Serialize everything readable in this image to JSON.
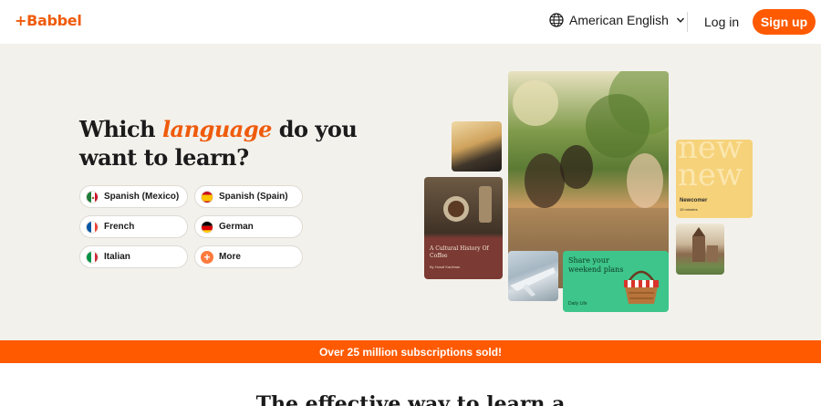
{
  "header": {
    "logo": "+Babbel",
    "language_selector": "American English",
    "login_label": "Log in",
    "signup_label": "Sign up"
  },
  "hero": {
    "title_before": "Which ",
    "title_highlight": "language",
    "title_after": " do you want to learn?",
    "languages": [
      {
        "label": "Spanish (Mexico)",
        "icon": "mexico-flag-icon"
      },
      {
        "label": "Spanish (Spain)",
        "icon": "spain-flag-icon"
      },
      {
        "label": "French",
        "icon": "france-flag-icon"
      },
      {
        "label": "German",
        "icon": "germany-flag-icon"
      },
      {
        "label": "Italian",
        "icon": "italy-flag-icon"
      },
      {
        "label": "More",
        "icon": "plus-icon"
      }
    ]
  },
  "collage": {
    "book_title": "A Cultural History Of Coffee",
    "book_author": "By Hosaf Kaufman",
    "newcomer_word": "new new",
    "newcomer_label": "Newcomer",
    "newcomer_sub": "10 minutes",
    "share_title": "Share your weekend plans",
    "share_tag": "Daily Life"
  },
  "banner": {
    "text": "Over 25 million subscriptions sold!"
  },
  "section": {
    "title": "The effective way to learn a"
  },
  "colors": {
    "brand_orange": "#ff5a00",
    "hero_bg": "#f3f1ec",
    "share_green": "#3ec58b"
  }
}
